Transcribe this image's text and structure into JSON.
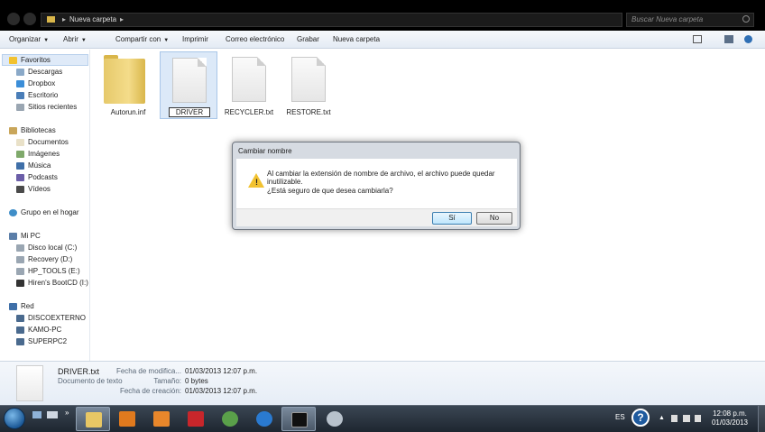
{
  "address": {
    "segments": [
      "Nueva carpeta"
    ],
    "search_placeholder": "Buscar Nueva carpeta"
  },
  "toolbar": {
    "organizar": "Organizar",
    "abrir": "Abrir",
    "compartir": "Compartir con",
    "imprimir": "Imprimir",
    "correo": "Correo electrónico",
    "grabar": "Grabar",
    "nueva_carpeta": "Nueva carpeta"
  },
  "nav": {
    "favoritos": "Favoritos",
    "fav_items": [
      "Descargas",
      "Dropbox",
      "Escritorio",
      "Sitios recientes"
    ],
    "bibliotecas": "Bibliotecas",
    "lib_items": [
      "Documentos",
      "Imágenes",
      "Música",
      "Podcasts",
      "Vídeos"
    ],
    "grupo_hogar": "Grupo en el hogar",
    "mi_pc": "Mi PC",
    "pc_items": [
      "Disco local (C:)",
      "Recovery (D:)",
      "HP_TOOLS (E:)",
      "Hiren's BootCD (I:)"
    ],
    "red": "Red",
    "red_items": [
      "DISCOEXTERNO",
      "KAMO-PC",
      "SUPERPC2"
    ]
  },
  "files": [
    {
      "name": "Autorun.inf",
      "kind": "folder"
    },
    {
      "name": "DRIVER",
      "kind": "document",
      "renaming": true
    },
    {
      "name": "RECYCLER.txt",
      "kind": "document"
    },
    {
      "name": "RESTORE.txt",
      "kind": "document"
    }
  ],
  "dialog": {
    "title": "Cambiar nombre",
    "message": "Al cambiar la extensión de nombre de archivo, el archivo puede quedar inutilizable.",
    "question": "¿Está seguro de que desea cambiarla?",
    "yes": "Sí",
    "no": "No"
  },
  "details": {
    "filename": "DRIVER.txt",
    "filetype": "Documento de texto",
    "modified_label": "Fecha de modifica...",
    "modified_value": "01/03/2013 12:07 p.m.",
    "size_label": "Tamaño:",
    "size_value": "0 bytes",
    "created_label": "Fecha de creación:",
    "created_value": "01/03/2013 12:07 p.m."
  },
  "taskbar": {
    "language": "ES",
    "time": "12:08 p.m.",
    "date": "01/03/2013",
    "apps": [
      "windows-explorer",
      "media-player",
      "mail",
      "pdf-reader",
      "messenger",
      "internet-explorer",
      "command-prompt",
      "tools"
    ]
  },
  "colors": {
    "accent": "#3c7fb1",
    "warning": "#f2c230",
    "taskbar": "#1e2630"
  }
}
